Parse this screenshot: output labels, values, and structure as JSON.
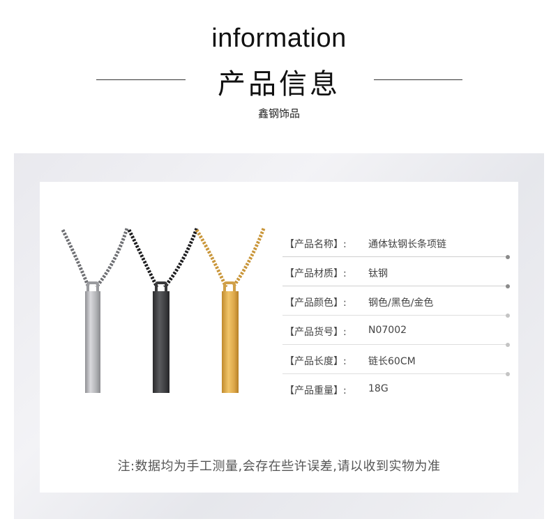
{
  "header": {
    "title_en": "information",
    "title_cn": "产品信息",
    "brand": "鑫钢饰品"
  },
  "specs": [
    {
      "label": "【产品名称】:",
      "value": "通体钛钢长条项链"
    },
    {
      "label": "【产品材质】:",
      "value": "钛钢"
    },
    {
      "label": "【产品颜色】:",
      "value": "钢色/黑色/金色"
    },
    {
      "label": "【产品货号】:",
      "value": "N07002"
    },
    {
      "label": "【产品长度】:",
      "value": "链长60CM"
    },
    {
      "label": "【产品重量】:",
      "value": "18G"
    }
  ],
  "note": "注:数据均为手工测量,会存在些许误差,请以收到实物为准",
  "colors": {
    "steel": "#b9b9bc",
    "black": "#3a3a3c",
    "gold": "#d8a746",
    "divider": "#cfcfcf",
    "backdrop": "#ececf0"
  },
  "icons": [
    "steel-necklace-icon",
    "black-necklace-icon",
    "gold-necklace-icon"
  ]
}
